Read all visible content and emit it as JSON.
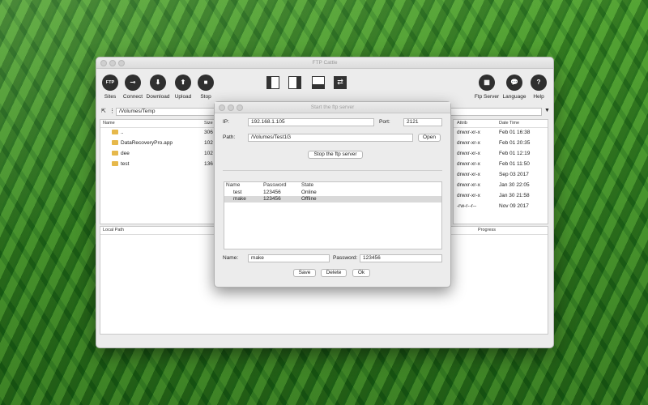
{
  "window": {
    "title": "FTP Cattle"
  },
  "toolbar": {
    "left": [
      {
        "label": "Sites",
        "icon": "ftp-icon",
        "glyph": "FTP"
      },
      {
        "label": "Connect",
        "icon": "connect-icon",
        "glyph": "⊸"
      },
      {
        "label": "Download",
        "icon": "download-icon",
        "glyph": "⬇"
      },
      {
        "label": "Upload",
        "icon": "upload-icon",
        "glyph": "⬆"
      },
      {
        "label": "Stop",
        "icon": "stop-icon",
        "glyph": "■"
      }
    ],
    "right": [
      {
        "label": "Ftp Server",
        "icon": "server-icon",
        "glyph": "▦"
      },
      {
        "label": "Language",
        "icon": "language-icon",
        "glyph": "💬"
      },
      {
        "label": "Help",
        "icon": "help-icon",
        "glyph": "?"
      }
    ]
  },
  "path": {
    "value": "/Volumes/Temp"
  },
  "local_list": {
    "headers": {
      "name": "Name",
      "size": "Size"
    },
    "rows": [
      {
        "name": "..",
        "size": "306"
      },
      {
        "name": "DataRecoveryPro.app",
        "size": "102"
      },
      {
        "name": "dee",
        "size": "102"
      },
      {
        "name": "test",
        "size": "136"
      }
    ]
  },
  "remote_list": {
    "headers": {
      "attrib": "Attrib",
      "date": "Date Time"
    },
    "rows": [
      {
        "attrib": "drwxr-xr-x",
        "date": "Feb 01 16:38"
      },
      {
        "attrib": "drwxr-xr-x",
        "date": "Feb 01 20:35"
      },
      {
        "attrib": "drwxr-xr-x",
        "date": "Feb 01 12:19"
      },
      {
        "attrib": "drwxr-xr-x",
        "date": "Feb 01 11:50"
      },
      {
        "attrib": "drwxr-xr-x",
        "date": "Sep 03 2017"
      },
      {
        "attrib": "drwxr-xr-x",
        "date": "Jan 30 22:05"
      },
      {
        "attrib": "drwxr-xr-x",
        "date": "Jan 30 21:58"
      },
      {
        "attrib": "-rw-r--r--",
        "date": "Nov 09 2017"
      }
    ]
  },
  "queue": {
    "headers": {
      "local_path": "Local Path",
      "progress": "Progress"
    }
  },
  "dialog": {
    "title": "Start the ftp server",
    "ip_label": "IP:",
    "ip_value": "192.168.1.105",
    "port_label": "Port:",
    "port_value": "2121",
    "path_label": "Path:",
    "path_value": "/Volumes/Test1G",
    "open_button": "Open",
    "stop_button": "Stop the ftp server",
    "users": {
      "headers": {
        "name": "Name",
        "password": "Password",
        "state": "State"
      },
      "rows": [
        {
          "name": "test",
          "password": "123456",
          "state": "Online"
        },
        {
          "name": "make",
          "password": "123456",
          "state": "Offline"
        }
      ]
    },
    "name_label": "Name:",
    "name_value": "make",
    "password_label": "Password:",
    "password_value": "123456",
    "save_button": "Save",
    "delete_button": "Delete",
    "ok_button": "Ok"
  }
}
